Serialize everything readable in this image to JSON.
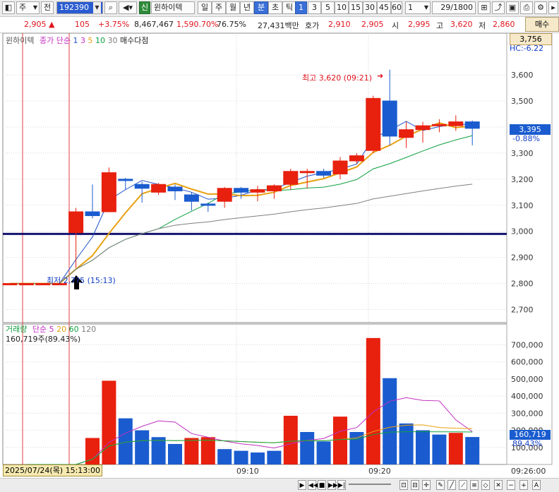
{
  "toolbar": {
    "period_mode": "주",
    "prev_label": "전",
    "stock_code": "192390",
    "market_badge": "신",
    "stock_name": "윈하이텍",
    "period_buttons": [
      "일",
      "주",
      "월",
      "년",
      "분",
      "초",
      "틱"
    ],
    "active_period": "분",
    "minute_buttons": [
      "1",
      "3",
      "5",
      "10",
      "15",
      "30",
      "45",
      "60"
    ],
    "active_minute": "1",
    "unit_value": "1",
    "page_count": "29/1800"
  },
  "quote": {
    "price": "2,905",
    "change_arrow": "▲",
    "change": "105",
    "change_rate": "+3.75%",
    "volume": "8,467,467",
    "volume_ratio": "1,590.70%",
    "strength": "76.75%",
    "amount": "27,431백만",
    "bid_label": "호가",
    "ask_price": "2,910",
    "bid_price": "2,905",
    "open_label": "시",
    "open": "2,995",
    "high_label": "고",
    "high": "3,620",
    "low_label": "저",
    "low": "2,860",
    "buy_button": "매수"
  },
  "price_legend": {
    "name": "윈하이텍",
    "ma_label": "종가 단순",
    "periods": [
      "1",
      "3",
      "5",
      "10",
      "30"
    ],
    "signal": "매수다점"
  },
  "volume_legend": {
    "name": "거래량",
    "ma_label": "단순",
    "periods": [
      "5",
      "20",
      "60",
      "120"
    ],
    "last_value": "160,719주(89.43%)"
  },
  "annotations": {
    "high_label": "최고 3,620 (09:21)",
    "low_label": "최저 2,7?5 (15:13)",
    "hc_label": "HC:-6.22",
    "top_box": "3,756",
    "current_price": "3,395",
    "current_pct": "-0.88%",
    "current_volume": "160,719",
    "current_volume_pct": "89.43%",
    "date_label": "2025/07/24(목) 15:13:00"
  },
  "colors": {
    "up": "#e8200e",
    "down": "#1a5ccf",
    "ma_blue": "#2050c8",
    "ma_orange": "#e8a010",
    "ma_green": "#10a040",
    "ma_gray": "#808080",
    "ma_magenta": "#c030c0",
    "level_line": "#14146e"
  },
  "chart_data": {
    "type": "candlestick",
    "price_axis": {
      "ylim": [
        2650,
        3760
      ],
      "ticks": [
        2700,
        2800,
        2900,
        3000,
        3100,
        3200,
        3300,
        3400,
        3500,
        3600
      ],
      "tick_labels": [
        "2,700",
        "2,800",
        "2,900",
        "3,000",
        "3,100",
        "3,200",
        "3,300",
        "3,400",
        "3,500",
        "3,600"
      ]
    },
    "volume_axis": {
      "ylim": [
        0,
        760000
      ],
      "ticks": [
        100000,
        200000,
        300000,
        400000,
        500000,
        600000,
        700000
      ],
      "tick_labels": [
        "100,000",
        "200,000",
        "300,000",
        "400,000",
        "500,000",
        "600,000",
        "700,000"
      ]
    },
    "x_labels": [
      "09:10",
      "09:20",
      "09:26:00"
    ],
    "reference_line": 2990,
    "candles": [
      {
        "o": 2800,
        "c": 2800,
        "h": 2800,
        "l": 2800
      },
      {
        "o": 2800,
        "c": 2800,
        "h": 2800,
        "l": 2800
      },
      {
        "o": 2800,
        "c": 2800,
        "h": 2800,
        "l": 2800
      },
      {
        "o": 2800,
        "c": 2800,
        "h": 2800,
        "l": 2795
      },
      {
        "o": 2995,
        "c": 3075,
        "h": 3090,
        "l": 2860
      },
      {
        "o": 3075,
        "c": 3060,
        "h": 3180,
        "l": 3050
      },
      {
        "o": 3075,
        "c": 3225,
        "h": 3245,
        "l": 3080
      },
      {
        "o": 3200,
        "c": 3195,
        "h": 3205,
        "l": 3160
      },
      {
        "o": 3180,
        "c": 3165,
        "h": 3190,
        "l": 3110
      },
      {
        "o": 3150,
        "c": 3180,
        "h": 3185,
        "l": 3140
      },
      {
        "o": 3170,
        "c": 3155,
        "h": 3180,
        "l": 3120
      },
      {
        "o": 3140,
        "c": 3115,
        "h": 3150,
        "l": 3080
      },
      {
        "o": 3105,
        "c": 3100,
        "h": 3110,
        "l": 3075
      },
      {
        "o": 3115,
        "c": 3165,
        "h": 3170,
        "l": 3090
      },
      {
        "o": 3165,
        "c": 3150,
        "h": 3170,
        "l": 3125
      },
      {
        "o": 3150,
        "c": 3160,
        "h": 3175,
        "l": 3115
      },
      {
        "o": 3155,
        "c": 3175,
        "h": 3180,
        "l": 3125
      },
      {
        "o": 3180,
        "c": 3230,
        "h": 3240,
        "l": 3160
      },
      {
        "o": 3225,
        "c": 3230,
        "h": 3240,
        "l": 3165
      },
      {
        "o": 3230,
        "c": 3215,
        "h": 3240,
        "l": 3205
      },
      {
        "o": 3220,
        "c": 3270,
        "h": 3285,
        "l": 3200
      },
      {
        "o": 3270,
        "c": 3290,
        "h": 3300,
        "l": 3260
      },
      {
        "o": 3310,
        "c": 3510,
        "h": 3520,
        "l": 3300
      },
      {
        "o": 3500,
        "c": 3365,
        "h": 3620,
        "l": 3330
      },
      {
        "o": 3360,
        "c": 3390,
        "h": 3420,
        "l": 3320
      },
      {
        "o": 3390,
        "c": 3405,
        "h": 3420,
        "l": 3340
      },
      {
        "o": 3410,
        "c": 3410,
        "h": 3430,
        "l": 3380
      },
      {
        "o": 3405,
        "c": 3420,
        "h": 3445,
        "l": 3385
      },
      {
        "o": 3420,
        "c": 3395,
        "h": 3425,
        "l": 3330
      }
    ],
    "volumes": [
      0,
      0,
      0,
      0,
      155000,
      490000,
      270000,
      200000,
      160000,
      120000,
      155000,
      160000,
      90000,
      80000,
      70000,
      80000,
      285000,
      190000,
      135000,
      280000,
      190000,
      740000,
      505000,
      240000,
      200000,
      175000,
      185000,
      160719
    ],
    "volume_up": [
      false,
      false,
      false,
      false,
      true,
      true,
      false,
      false,
      false,
      false,
      true,
      true,
      false,
      false,
      false,
      false,
      true,
      false,
      false,
      true,
      false,
      true,
      false,
      false,
      false,
      false,
      true,
      false
    ]
  }
}
